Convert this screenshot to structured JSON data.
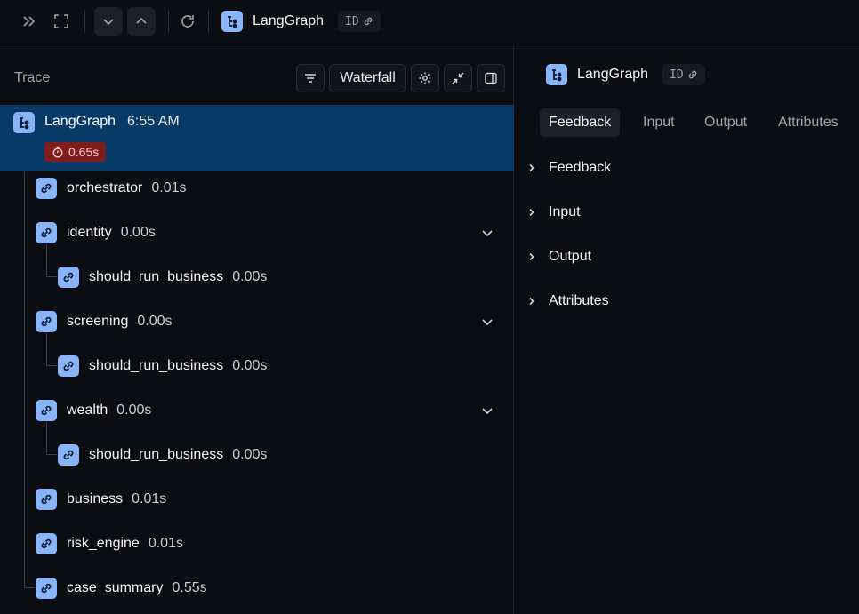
{
  "topbar": {
    "app_title": "LangGraph",
    "id_label": "ID",
    "icons": [
      "double-chevron-right-icon",
      "expand-icon",
      "chevron-down-icon",
      "chevron-up-icon",
      "refresh-icon",
      "langgraph-icon",
      "link-icon"
    ]
  },
  "trace_panel": {
    "label": "Trace",
    "waterfall_label": "Waterfall",
    "root": {
      "name": "LangGraph",
      "time": "6:55 AM",
      "duration": "0.65s"
    },
    "nodes": [
      {
        "name": "orchestrator",
        "duration": "0.01s"
      },
      {
        "name": "identity",
        "duration": "0.00s"
      },
      {
        "name": "should_run_business",
        "duration": "0.00s"
      },
      {
        "name": "screening",
        "duration": "0.00s"
      },
      {
        "name": "should_run_business",
        "duration": "0.00s"
      },
      {
        "name": "wealth",
        "duration": "0.00s"
      },
      {
        "name": "should_run_business",
        "duration": "0.00s"
      },
      {
        "name": "business",
        "duration": "0.01s"
      },
      {
        "name": "risk_engine",
        "duration": "0.01s"
      },
      {
        "name": "case_summary",
        "duration": "0.55s"
      }
    ]
  },
  "detail_panel": {
    "title": "LangGraph",
    "id_label": "ID",
    "tabs": [
      "Feedback",
      "Input",
      "Output",
      "Attributes"
    ],
    "active_tab": "Feedback",
    "sections": [
      "Feedback",
      "Input",
      "Output",
      "Attributes"
    ]
  },
  "colors": {
    "accent": "#8ab4f8",
    "selected_row": "#073a66",
    "duration_badge": "#7f1d1d",
    "background": "#0b0d13"
  }
}
